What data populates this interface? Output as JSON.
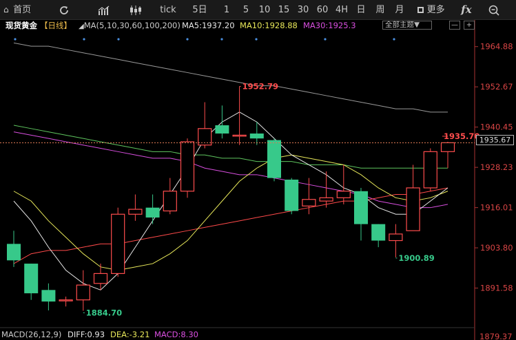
{
  "toolbar": {
    "home_label": "首页",
    "tick_label": "tick",
    "periods": [
      "5日",
      "1",
      "5",
      "10",
      "15",
      "30",
      "60",
      "4H",
      "日",
      "周",
      "月"
    ],
    "more_label": "更多",
    "fx_label": "fx"
  },
  "legend": {
    "instrument": "现货黄金",
    "period": "【日线】",
    "ma_params": "MA(5,10,30,60,100,200)",
    "ma5": "MA5:1937.20",
    "ma10": "MA10:1928.88",
    "ma30": "MA30:1925.3",
    "theme_select": "全部主题▼",
    "minus": "—",
    "plus": "+"
  },
  "price_axis": {
    "ticks": [
      "1964.88",
      "1952.67",
      "1940.45",
      "1928.23",
      "1916.01",
      "1903.80",
      "1891.58"
    ],
    "bottom_tick": "1879.37",
    "current_price": "1935.67"
  },
  "colors": {
    "up": "#ff4d4d",
    "down": "#37c98a",
    "ma5": "#e6e6e6",
    "ma10": "#e8e85a",
    "ma30": "#d94fe0",
    "ma60": "#5fc65f",
    "ma100": "#ff4a4a",
    "ma200": "#9a9a9a"
  },
  "chart_data": {
    "type": "candlestick",
    "ylim": [
      1880,
      1969
    ],
    "candles": [
      {
        "open": 1905.0,
        "close": 1900.0,
        "high": 1909.0,
        "low": 1898.0
      },
      {
        "open": 1899.0,
        "close": 1890.0,
        "high": 1899.0,
        "low": 1888.0
      },
      {
        "open": 1891.0,
        "close": 1887.5,
        "high": 1893.0,
        "low": 1884.8
      },
      {
        "open": 1888.0,
        "close": 1888.0,
        "high": 1889.0,
        "low": 1886.0
      },
      {
        "open": 1888.0,
        "close": 1892.5,
        "high": 1897.0,
        "low": 1884.7
      },
      {
        "open": 1893.0,
        "close": 1896.0,
        "high": 1899.0,
        "low": 1891.0
      },
      {
        "open": 1896.0,
        "close": 1914.0,
        "high": 1916.0,
        "low": 1895.0
      },
      {
        "open": 1914.0,
        "close": 1915.5,
        "high": 1920.0,
        "low": 1912.0
      },
      {
        "open": 1916.0,
        "close": 1913.0,
        "high": 1920.0,
        "low": 1911.0
      },
      {
        "open": 1915.0,
        "close": 1921.0,
        "high": 1925.0,
        "low": 1914.0
      },
      {
        "open": 1921.0,
        "close": 1936.0,
        "high": 1937.0,
        "low": 1919.0
      },
      {
        "open": 1935.0,
        "close": 1940.0,
        "high": 1948.0,
        "low": 1934.0
      },
      {
        "open": 1941.0,
        "close": 1938.5,
        "high": 1947.0,
        "low": 1937.0
      },
      {
        "open": 1938.0,
        "close": 1938.0,
        "high": 1952.8,
        "low": 1935.0
      },
      {
        "open": 1938.5,
        "close": 1937.0,
        "high": 1942.0,
        "low": 1935.0
      },
      {
        "open": 1936.5,
        "close": 1925.0,
        "high": 1937.0,
        "low": 1924.0
      },
      {
        "open": 1924.5,
        "close": 1915.0,
        "high": 1925.0,
        "low": 1914.0
      },
      {
        "open": 1916.5,
        "close": 1918.5,
        "high": 1925.0,
        "low": 1914.0
      },
      {
        "open": 1918.0,
        "close": 1919.0,
        "high": 1927.0,
        "low": 1916.0
      },
      {
        "open": 1919.0,
        "close": 1921.0,
        "high": 1929.0,
        "low": 1917.0
      },
      {
        "open": 1921.0,
        "close": 1911.0,
        "high": 1922.0,
        "low": 1906.0
      },
      {
        "open": 1911.0,
        "close": 1906.0,
        "high": 1911.0,
        "low": 1904.0
      },
      {
        "open": 1906.0,
        "close": 1908.0,
        "high": 1911.0,
        "low": 1900.9
      },
      {
        "open": 1909.0,
        "close": 1922.0,
        "high": 1929.0,
        "low": 1909.0
      },
      {
        "open": 1922.0,
        "close": 1933.0,
        "high": 1934.0,
        "low": 1921.0
      },
      {
        "open": 1933.0,
        "close": 1935.7,
        "high": 1936.0,
        "low": 1928.0
      }
    ],
    "ma5": [
      1918,
      1912,
      1904,
      1897,
      1893,
      1891,
      1896,
      1904,
      1912,
      1920,
      1928,
      1937,
      1942,
      1945,
      1942,
      1937,
      1932,
      1929,
      1926,
      1922,
      1920,
      1916,
      1914,
      1914,
      1918,
      1922
    ],
    "ma10": [
      1921,
      1918,
      1912,
      1907,
      1902,
      1898,
      1897,
      1898,
      1899,
      1902,
      1906,
      1912,
      1918,
      1924,
      1928,
      1931,
      1932,
      1931,
      1930,
      1929,
      1926,
      1922,
      1919,
      1918,
      1919,
      1921
    ],
    "ma30": [
      1939,
      1938,
      1937,
      1936,
      1935,
      1934,
      1933,
      1932,
      1931,
      1931,
      1930,
      1928,
      1927,
      1926,
      1926,
      1925,
      1924,
      1923,
      1922,
      1921,
      1920,
      1918,
      1917,
      1916,
      1916,
      1917
    ],
    "ma60": [
      1941,
      1940,
      1939,
      1938,
      1937,
      1936,
      1935,
      1934,
      1933,
      1933,
      1932,
      1932,
      1931,
      1931,
      1930,
      1930,
      1930,
      1929,
      1929,
      1929,
      1928,
      1928,
      1928,
      1928,
      1928,
      1928
    ],
    "ma100": [
      1899,
      1902,
      1903,
      1903,
      1904,
      1905,
      1905,
      1906,
      1907,
      1908,
      1909,
      1910,
      1911,
      1912,
      1913,
      1914,
      1915,
      1916,
      1917,
      1918,
      1918,
      1919,
      1920,
      1920,
      1921,
      1922
    ],
    "ma200": [
      1966,
      1965,
      1965,
      1964,
      1963,
      1962,
      1961,
      1960,
      1959,
      1958,
      1957,
      1956,
      1955,
      1954,
      1953,
      1953,
      1952,
      1951,
      1950,
      1949,
      1948,
      1947,
      1946,
      1946,
      1945,
      1945
    ],
    "annotations": {
      "high": "1952.79",
      "low": "1884.70",
      "swing_low": "1900.89",
      "last": "1935.70"
    }
  },
  "macd": {
    "label": "MACD(26,12,9)",
    "diff": "DIFF:0.93",
    "dea": "DEA:-3.21",
    "macd": "MACD:8.30"
  }
}
